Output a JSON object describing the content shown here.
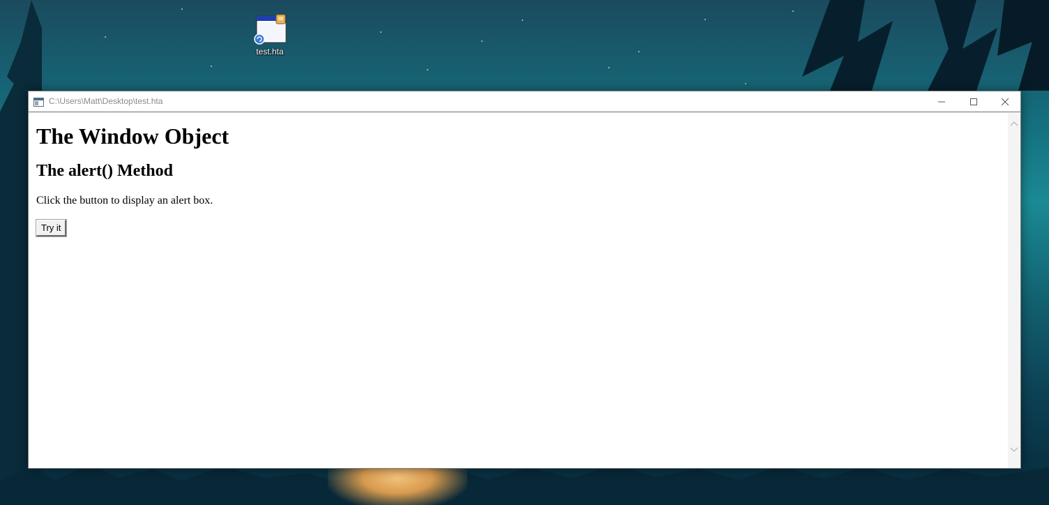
{
  "desktop": {
    "icons": [
      {
        "label": "test.hta",
        "icon": "hta-file-icon"
      }
    ]
  },
  "window": {
    "title": "C:\\Users\\Matt\\Desktop\\test.hta",
    "controls": [
      "minimize-icon",
      "maximize-icon",
      "close-icon"
    ]
  },
  "page": {
    "heading": "The Window Object",
    "subheading": "The alert() Method",
    "paragraph": "Click the button to display an alert box.",
    "button_label": "Try it"
  },
  "colors": {
    "title_text": "#8a8a8a",
    "window_bg": "#ffffff",
    "desktop_teal": "#14707f"
  }
}
